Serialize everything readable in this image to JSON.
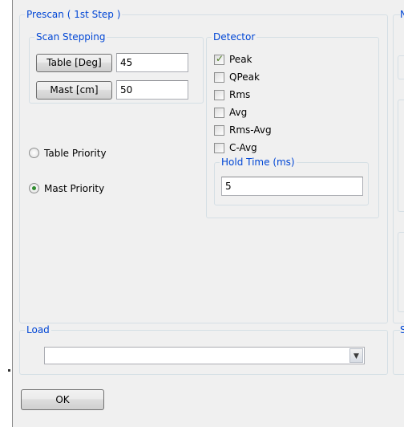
{
  "prescan": {
    "title": "Prescan ( 1st Step )",
    "scan_stepping": {
      "title": "Scan Stepping",
      "table_button": "Table [Deg]",
      "table_value": "45",
      "mast_button": "Mast [cm]",
      "mast_value": "50"
    },
    "priority": {
      "table_label": "Table Priority",
      "mast_label": "Mast Priority",
      "selected": "mast"
    },
    "detector": {
      "title": "Detector",
      "options": [
        {
          "label": "Peak",
          "checked": true
        },
        {
          "label": "QPeak",
          "checked": false
        },
        {
          "label": "Rms",
          "checked": false
        },
        {
          "label": "Avg",
          "checked": false
        },
        {
          "label": "Rms-Avg",
          "checked": false
        },
        {
          "label": "C-Avg",
          "checked": false
        }
      ],
      "hold_time": {
        "title": "Hold Time (ms)",
        "value": "5"
      }
    }
  },
  "load": {
    "title": "Load",
    "value": ""
  },
  "right_cut": {
    "top_char": "N",
    "bottom_char": "S"
  },
  "ok_button": "OK"
}
